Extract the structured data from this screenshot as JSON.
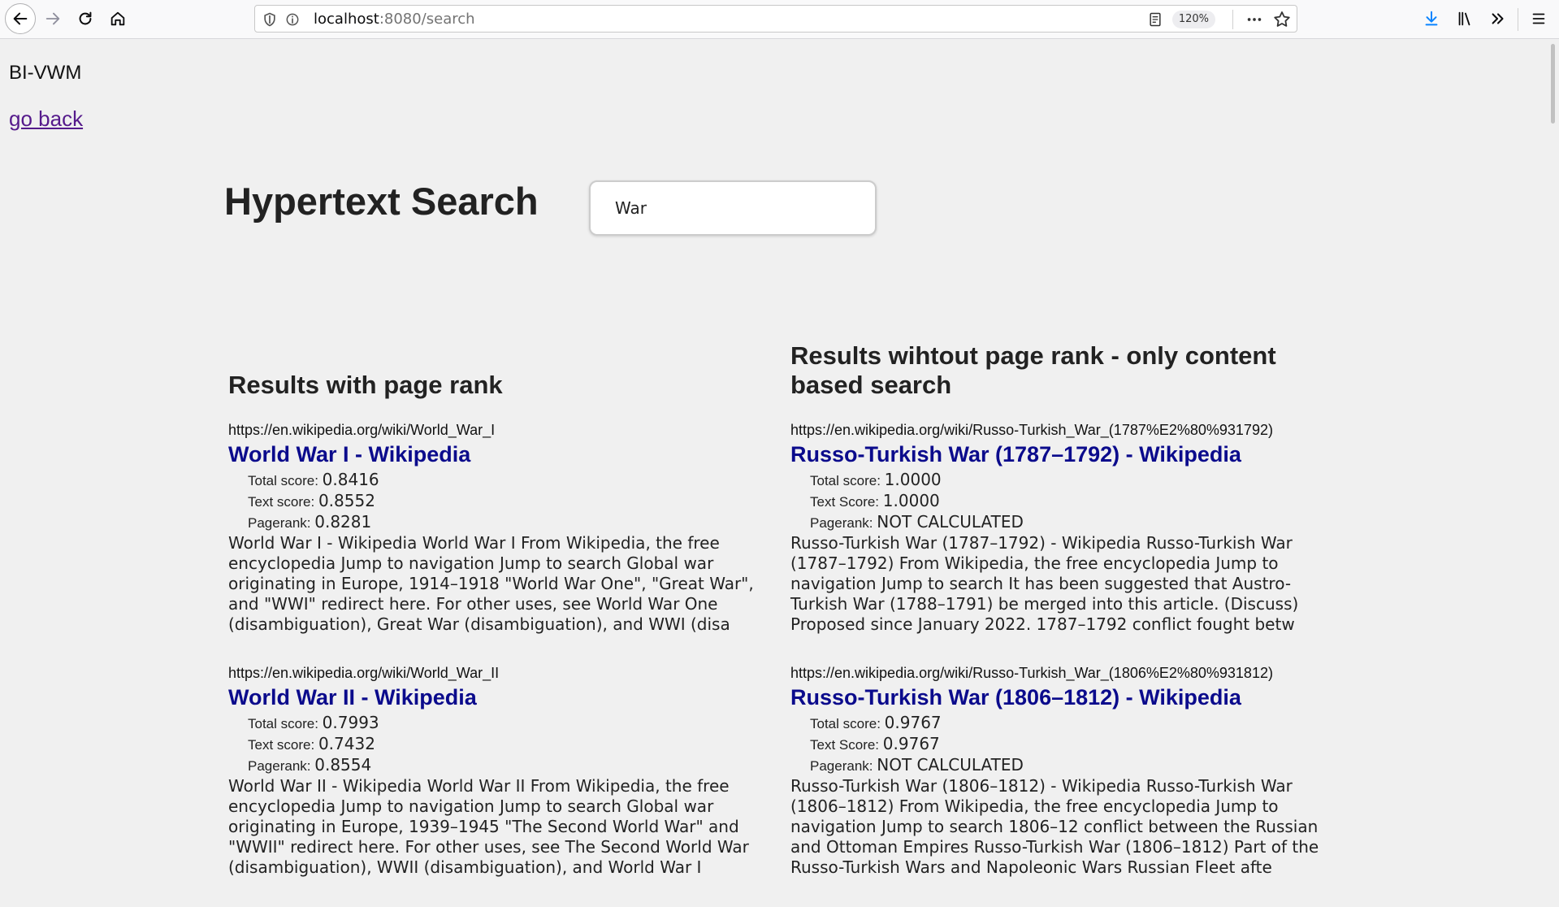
{
  "browser": {
    "url_host": "localhost",
    "url_rest": ":8080/search",
    "zoom": "120%"
  },
  "page": {
    "site_name": "BI-VWM",
    "back_link": "go back",
    "title": "Hypertext Search",
    "search_value": "War"
  },
  "left": {
    "heading": "Results with page rank",
    "results": [
      {
        "url": "https://en.wikipedia.org/wiki/World_War_I",
        "title": "World War I - Wikipedia",
        "total_label": "Total score:",
        "total": "0.8416",
        "text_label": "Text score:",
        "text_score": "0.8552",
        "pr_label": "Pagerank:",
        "pagerank": "0.8281",
        "snippet": "World War I - Wikipedia World War I From Wikipedia, the free encyclopedia Jump to navigation Jump to search Global war originating in Europe, 1914–1918 \"World War One\", \"Great War\", and \"WWI\" redirect here. For other uses, see World War One (disambiguation), Great War (disambiguation), and WWI (disa"
      },
      {
        "url": "https://en.wikipedia.org/wiki/World_War_II",
        "title": "World War II - Wikipedia",
        "total_label": "Total score:",
        "total": "0.7993",
        "text_label": "Text score:",
        "text_score": "0.7432",
        "pr_label": "Pagerank:",
        "pagerank": "0.8554",
        "snippet": "World War II - Wikipedia World War II From Wikipedia, the free encyclopedia Jump to navigation Jump to search Global war originating in Europe, 1939–1945 \"The Second World War\" and \"WWII\" redirect here. For other uses, see The Second World War (disambiguation), WWII (disambiguation), and World War I"
      }
    ]
  },
  "right": {
    "heading": "Results wihtout page rank - only content based search",
    "results": [
      {
        "url": "https://en.wikipedia.org/wiki/Russo-Turkish_War_(1787%E2%80%931792)",
        "title": "Russo-Turkish War (1787–1792) - Wikipedia",
        "total_label": "Total score:",
        "total": "1.0000",
        "text_label": "Text Score:",
        "text_score": "1.0000",
        "pr_label": "Pagerank:",
        "pagerank": "NOT CALCULATED",
        "snippet": "Russo-Turkish War (1787–1792) - Wikipedia Russo-Turkish War (1787–1792) From Wikipedia, the free encyclopedia Jump to navigation Jump to search It has been suggested that Austro-Turkish War (1788–1791) be merged into this article. (Discuss) Proposed since January 2022. 1787–1792 conflict fought betw"
      },
      {
        "url": "https://en.wikipedia.org/wiki/Russo-Turkish_War_(1806%E2%80%931812)",
        "title": "Russo-Turkish War (1806–1812) - Wikipedia",
        "total_label": "Total score:",
        "total": "0.9767",
        "text_label": "Text Score:",
        "text_score": "0.9767",
        "pr_label": "Pagerank:",
        "pagerank": "NOT CALCULATED",
        "snippet": "Russo-Turkish War (1806–1812) - Wikipedia Russo-Turkish War (1806–1812) From Wikipedia, the free encyclopedia Jump to navigation Jump to search 1806–12 conflict between the Russian and Ottoman Empires Russo-Turkish War (1806–1812) Part of the Russo-Turkish Wars and Napoleonic Wars Russian Fleet afte"
      }
    ]
  },
  "colors": {
    "link_title": "#0b0b8c",
    "visited_link": "#551a8b",
    "page_bg": "#f0f0f0"
  }
}
